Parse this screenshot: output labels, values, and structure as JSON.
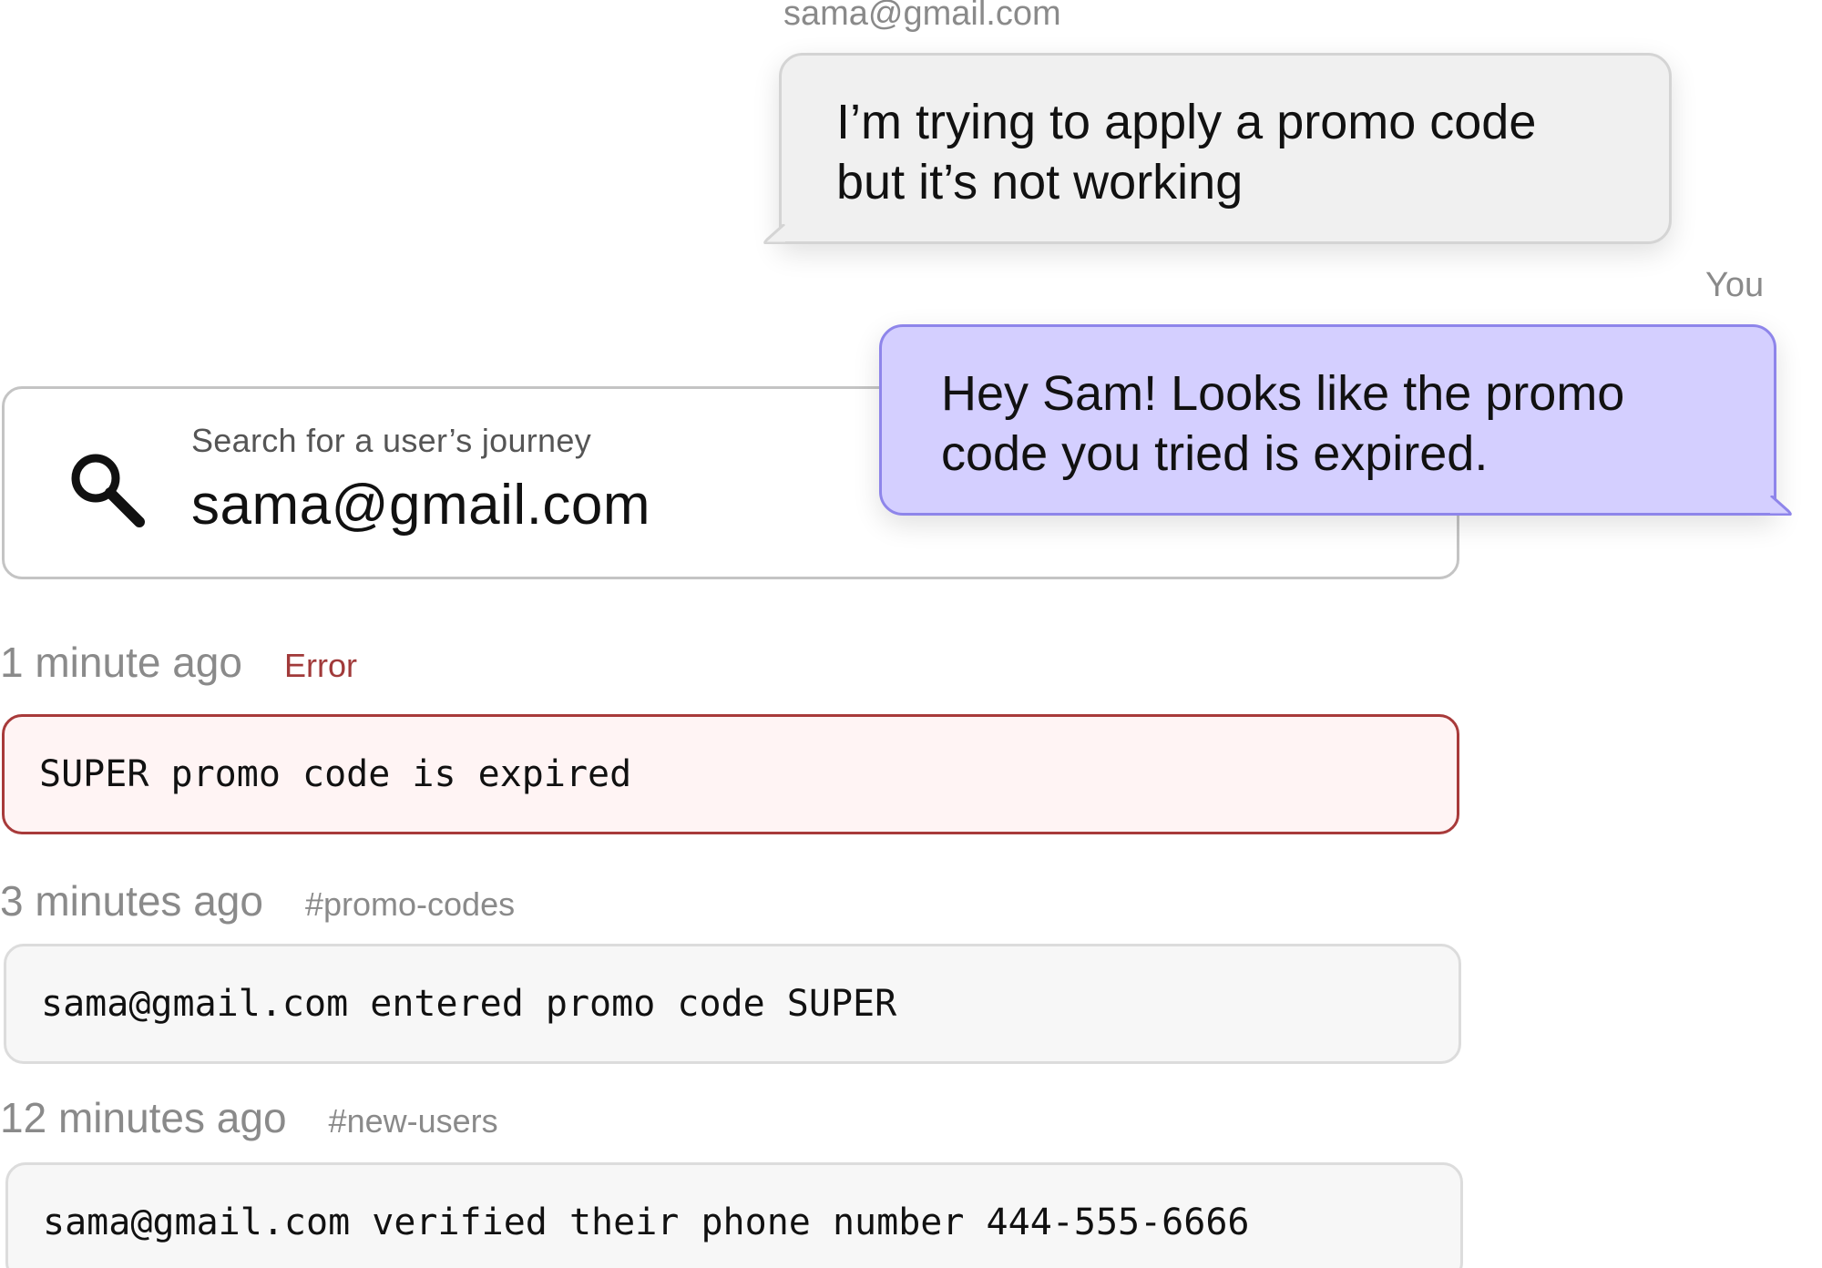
{
  "search": {
    "label": "Search for a user’s journey",
    "value": "sama@gmail.com",
    "icon": "search-icon"
  },
  "chat": {
    "user_message": {
      "sender": "sama@gmail.com",
      "text": "I’m trying to apply a promo code but it’s not working"
    },
    "agent_message": {
      "sender": "You",
      "text": "Hey Sam! Looks like the promo code you tried is expired."
    }
  },
  "logs": [
    {
      "time": "1 minute ago",
      "tag": "Error",
      "message": "SUPER promo code is expired",
      "status": "error"
    },
    {
      "time": "3 minutes ago",
      "tag": "#promo-codes",
      "message": "sama@gmail.com entered promo code SUPER",
      "status": "normal"
    },
    {
      "time": "12 minutes ago",
      "tag": "#new-users",
      "message": "sama@gmail.com verified their phone number 444-555-6666",
      "status": "normal"
    }
  ],
  "colors": {
    "error_red": "#a13a3a",
    "error_bg": "#fff4f4",
    "agent_bubble": "#d4cfff",
    "agent_border": "#8e85ea",
    "user_bubble": "#f0f0f0"
  }
}
